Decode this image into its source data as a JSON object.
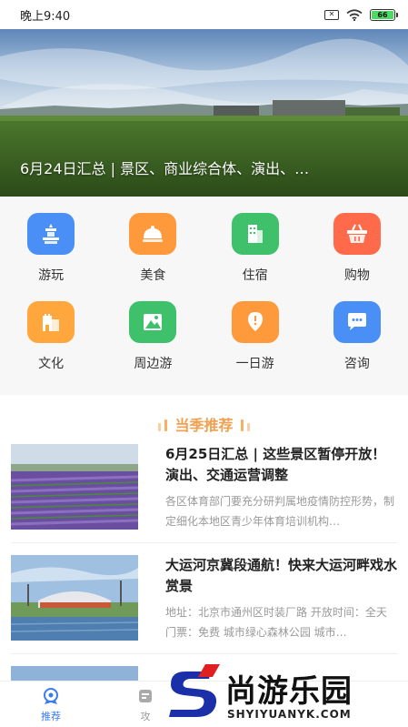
{
  "status_bar": {
    "time": "晚上9:40",
    "battery": "66"
  },
  "banner": {
    "caption": "6月24日汇总 | 景区、商业综合体、演出、…",
    "dot_count": 5,
    "active_dot": 4
  },
  "categories": [
    {
      "label": "游玩",
      "icon": "temple-icon",
      "color": "#4a8ff5"
    },
    {
      "label": "美食",
      "icon": "cloche-icon",
      "color": "#ff9a3c"
    },
    {
      "label": "住宿",
      "icon": "building-icon",
      "color": "#3fc06a"
    },
    {
      "label": "购物",
      "icon": "basket-icon",
      "color": "#ff6b4a"
    },
    {
      "label": "文化",
      "icon": "castle-icon",
      "color": "#ffa63c"
    },
    {
      "label": "周边游",
      "icon": "mountain-icon",
      "color": "#3fc06a"
    },
    {
      "label": "一日游",
      "icon": "location-pin-icon",
      "color": "#ff9a3c"
    },
    {
      "label": "咨询",
      "icon": "chat-bubble-icon",
      "color": "#4a8ff5"
    }
  ],
  "section": {
    "title": "当季推荐"
  },
  "articles": [
    {
      "title": "6月25日汇总 | 这些景区暂停开放！演出、交通运营调整",
      "desc": "各区体育部门要充分研判属地疫情防控形势，制定细化本地区青少年体育培训机构…"
    },
    {
      "title": "大运河京冀段通航！快来大运河畔戏水赏景",
      "desc": "地址：北京市通州区时装厂路 开放时间：全天 门票：免费 城市绿心森林公园 城市…"
    }
  ],
  "bottom_nav": [
    {
      "label": "推荐",
      "active": true
    },
    {
      "label": "攻",
      "active": false
    }
  ],
  "watermark": {
    "text": "尚游乐园",
    "sub": "SHYIYUANYK.COM"
  },
  "colors": {
    "accent": "#3a7bf0",
    "section_title": "#f0a050"
  }
}
